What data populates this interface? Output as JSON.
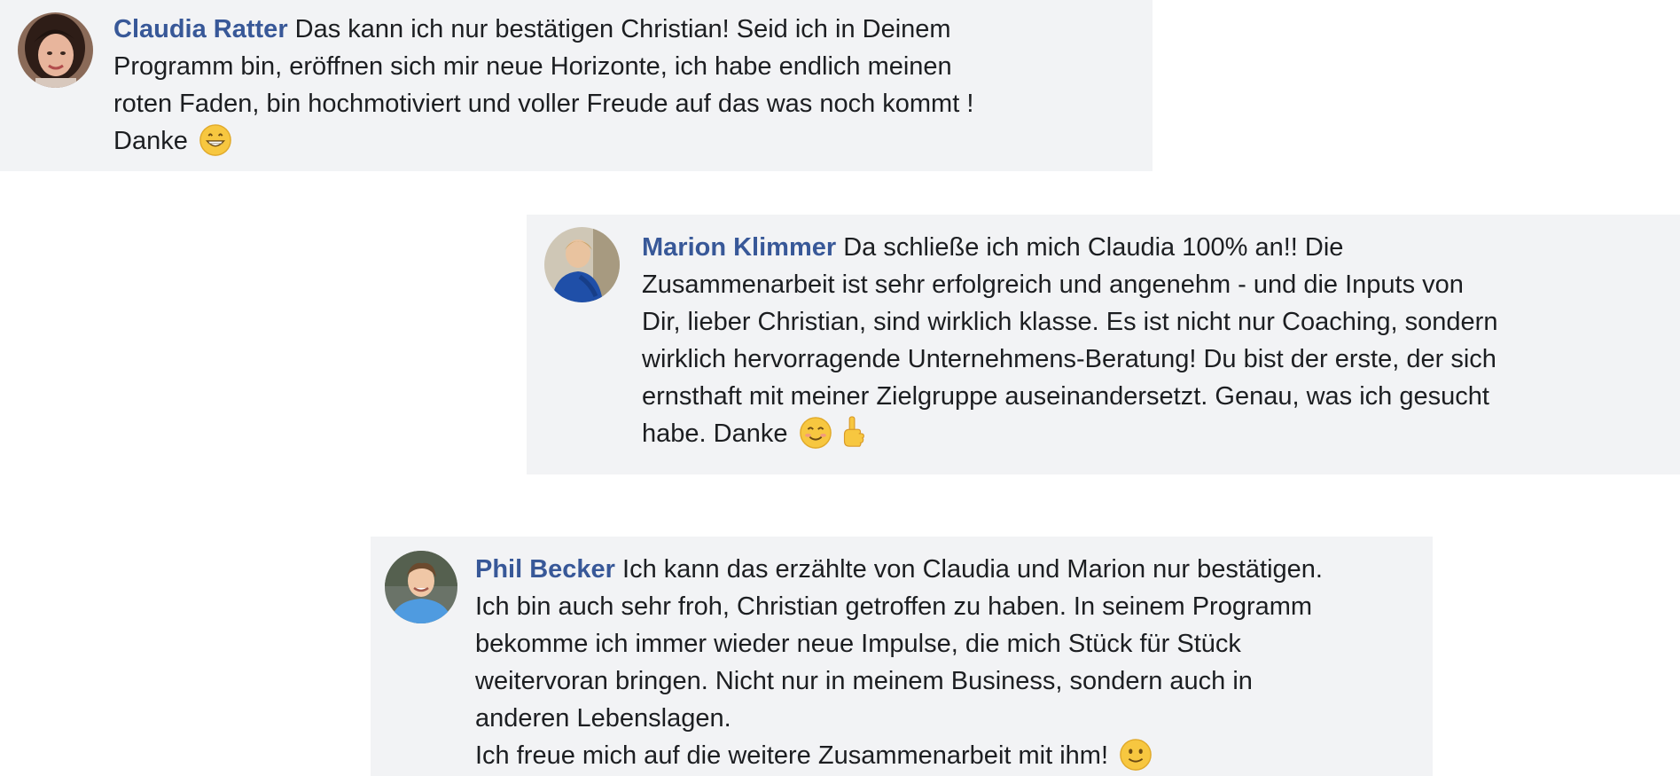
{
  "comments": [
    {
      "author": "Claudia Ratter",
      "lines": [
        "Das kann ich nur bestätigen Christian! Seid ich in Deinem",
        "Programm bin, eröffnen sich mir neue Horizonte, ich habe endlich meinen",
        "roten Faden, bin hochmotiviert und voller Freude auf das was noch kommt !",
        "Danke"
      ],
      "emojis": [
        "grinning-face-emoji"
      ]
    },
    {
      "author": "Marion Klimmer",
      "lines": [
        "Da schließe ich mich Claudia 100% an!! Die",
        "Zusammenarbeit ist sehr erfolgreich und angenehm - und die Inputs von",
        "Dir, lieber Christian, sind wirklich klasse. Es ist nicht nur Coaching, sondern",
        "wirklich hervorragende Unternehmens-Beratung! Du bist der erste, der sich",
        "ernsthaft mit meiner Zielgruppe auseinandersetzt. Genau, was ich gesucht",
        "habe. Danke"
      ],
      "emojis": [
        "smiling-face-emoji",
        "pointing-hand-emoji"
      ]
    },
    {
      "author": "Phil Becker",
      "lines": [
        "Ich kann das erzählte von Claudia und Marion nur bestätigen.",
        "Ich bin auch sehr froh, Christian getroffen zu haben. In seinem Programm",
        "bekomme ich immer wieder neue Impulse, die mich Stück für Stück",
        "weitervoran bringen. Nicht nur in meinem Business, sondern auch in",
        "anderen Lebenslagen.",
        "Ich freue mich auf die weitere Zusammenarbeit mit ihm!"
      ],
      "emojis": [
        "slightly-smiling-face-emoji"
      ]
    }
  ],
  "colors": {
    "bubble_bg": "#f2f3f5",
    "author": "#385898",
    "text": "#1c1e21"
  }
}
